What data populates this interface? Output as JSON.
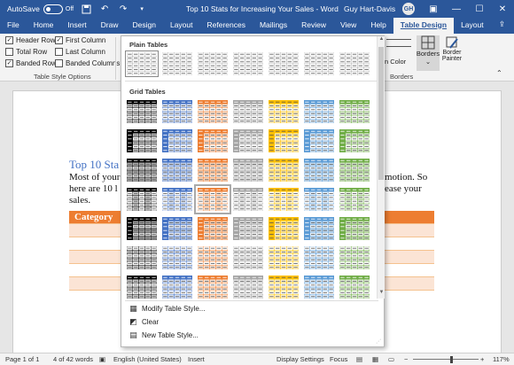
{
  "titlebar": {
    "autosave": "AutoSave",
    "autosave_state": "Off",
    "doc_title": "Top 10 Stats for Increasing Your Sales  -  Word",
    "user": "Guy Hart-Davis",
    "avatar": "GH",
    "bg": "#2b579a"
  },
  "tabs": [
    "File",
    "Home",
    "Insert",
    "Draw",
    "Design",
    "Layout",
    "References",
    "Mailings",
    "Review",
    "View",
    "Help",
    "Table Design",
    "Layout"
  ],
  "ribbon": {
    "options": [
      "Header Row",
      "Total Row",
      "Banded Rows",
      "First Column",
      "Last Column",
      "Banded Columns"
    ],
    "options_checked": [
      true,
      false,
      true,
      true,
      false,
      false
    ],
    "group_label_options": "Table Style Options",
    "pen_color": "n Color",
    "borders_label": "Borders",
    "border_painter": "Border Painter",
    "group_label_borders": "Borders"
  },
  "document": {
    "heading": "Top 10 Sta",
    "para_left": [
      "Most of your",
      "here are 10 l",
      "sales."
    ],
    "para_right": [
      "motion. So",
      "ease your"
    ],
    "table_header": "Category",
    "accent": "#ed7d31"
  },
  "gallery": {
    "plain_label": "Plain Tables",
    "grid_label": "Grid Tables",
    "menu": [
      "Modify Table Style...",
      "Clear",
      "New Table Style..."
    ],
    "palette": [
      "#000000",
      "#4472c4",
      "#ed7d31",
      "#a5a5a5",
      "#ffc000",
      "#5b9bd5",
      "#70ad47"
    ]
  },
  "status": {
    "page": "Page 1 of 1",
    "words": "4 of 42 words",
    "language": "English (United States)",
    "mode": "Insert",
    "display": "Display Settings",
    "focus": "Focus",
    "zoom": "117%"
  }
}
